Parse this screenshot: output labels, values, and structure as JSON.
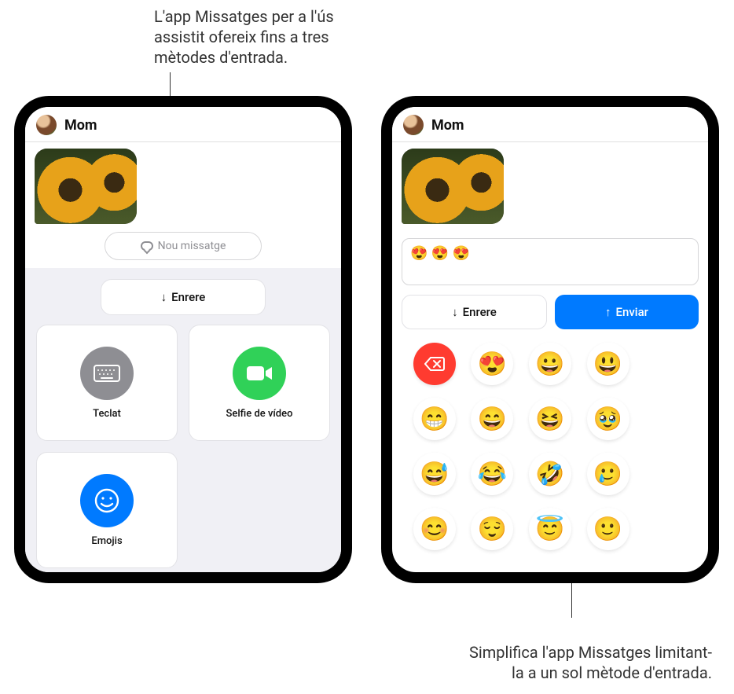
{
  "annotations": {
    "top": "L'app Missatges per a l'ús assistit ofereix fins a tres mètodes d'entrada.",
    "bottom": "Simplifica l'app Missatges limitant-la a un sol mètode d'entrada."
  },
  "left": {
    "contact": "Mom",
    "new_message_placeholder": "Nou missatge",
    "back_label": "Enrere",
    "tiles": {
      "keyboard": "Teclat",
      "video": "Selfie de vídeo",
      "emoji": "Emojis"
    }
  },
  "right": {
    "contact": "Mom",
    "compose_text": "😍 😍 😍",
    "back_label": "Enrere",
    "send_label": "Enviar",
    "emoji_keys": [
      "😍",
      "😀",
      "😃",
      "😁",
      "😄",
      "😆",
      "🥹",
      "😅",
      "😂",
      "🤣",
      "🥲",
      "😊",
      "😌",
      "😇",
      "🙂"
    ]
  }
}
